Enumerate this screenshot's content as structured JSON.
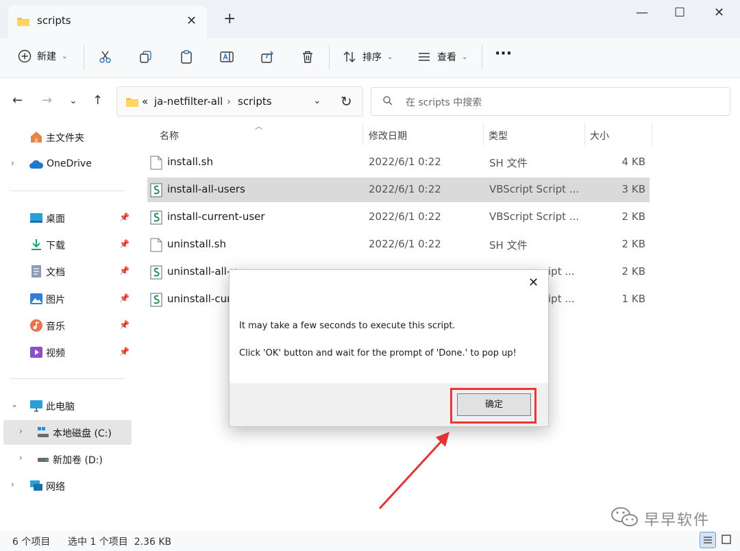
{
  "window": {
    "tab_title": "scripts",
    "tab_close": "✕",
    "new_tab": "+",
    "minimize": "—",
    "maximize": "☐",
    "close": "✕"
  },
  "toolbar": {
    "new_label": "新建",
    "sort_label": "排序",
    "view_label": "查看",
    "more_label": "···"
  },
  "address": {
    "overflow": "«",
    "crumbs": [
      "ja-netfilter-all",
      "scripts"
    ],
    "separator": "›",
    "search_placeholder": "在 scripts 中搜索"
  },
  "sidebar": {
    "items": [
      {
        "label": "主文件夹",
        "icon": "home-icon"
      },
      {
        "label": "OneDrive",
        "icon": "cloud-icon"
      },
      {
        "label": "桌面",
        "icon": "desktop-icon"
      },
      {
        "label": "下载",
        "icon": "download-icon"
      },
      {
        "label": "文档",
        "icon": "documents-icon"
      },
      {
        "label": "图片",
        "icon": "pictures-icon"
      },
      {
        "label": "音乐",
        "icon": "music-icon"
      },
      {
        "label": "视频",
        "icon": "videos-icon"
      },
      {
        "label": "此电脑",
        "icon": "computer-icon"
      },
      {
        "label": "本地磁盘 (C:)",
        "icon": "drive-icon"
      },
      {
        "label": "新加卷 (D:)",
        "icon": "drive-icon"
      },
      {
        "label": "网络",
        "icon": "network-icon"
      }
    ]
  },
  "columns": {
    "name": "名称",
    "modified": "修改日期",
    "type": "类型",
    "size": "大小"
  },
  "files": [
    {
      "name": "install.sh",
      "date": "2022/6/1 0:22",
      "type": "SH 文件",
      "size": "4 KB",
      "icon": "text-file-icon"
    },
    {
      "name": "install-all-users",
      "date": "2022/6/1 0:22",
      "type": "VBScript Script ...",
      "size": "3 KB",
      "icon": "script-file-icon"
    },
    {
      "name": "install-current-user",
      "date": "2022/6/1 0:22",
      "type": "VBScript Script ...",
      "size": "2 KB",
      "icon": "script-file-icon"
    },
    {
      "name": "uninstall.sh",
      "date": "2022/6/1 0:22",
      "type": "SH 文件",
      "size": "2 KB",
      "icon": "text-file-icon"
    },
    {
      "name": "uninstall-all-u",
      "date": "",
      "type": "ipt ...",
      "size": "2 KB",
      "icon": "script-file-icon"
    },
    {
      "name": "uninstall-curr",
      "date": "",
      "type": "ipt ...",
      "size": "1 KB",
      "icon": "script-file-icon"
    }
  ],
  "status": {
    "count": "6 个项目",
    "selected": "选中 1 个项目  2.36 KB"
  },
  "dialog": {
    "close": "✕",
    "message_1": "It may take a few seconds to execute this script.",
    "message_2": "Click 'OK' button and wait for the prompt of 'Done.' to pop up!",
    "ok_label": "确定"
  },
  "watermark": {
    "text": "早早软件"
  },
  "colors": {
    "selection": "#dadada",
    "annotation": "#e33333",
    "folder": "#f5c242"
  }
}
